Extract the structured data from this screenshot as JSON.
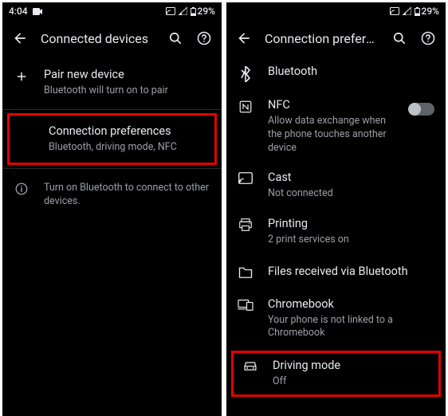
{
  "statusbar": {
    "time": "4:04",
    "battery": "29%"
  },
  "left": {
    "title": "Connected devices",
    "rows": [
      {
        "primary": "Pair new device",
        "secondary": "Bluetooth will turn on to pair"
      },
      {
        "primary": "Connection preferences",
        "secondary": "Bluetooth, driving mode, NFC"
      }
    ],
    "info": "Turn on Bluetooth to connect to other devices."
  },
  "right": {
    "title": "Connection preferen...",
    "rows": [
      {
        "primary": "Bluetooth"
      },
      {
        "primary": "NFC",
        "secondary": "Allow data exchange when the phone touches another device"
      },
      {
        "primary": "Cast",
        "secondary": "Not connected"
      },
      {
        "primary": "Printing",
        "secondary": "2 print services on"
      },
      {
        "primary": "Files received via Bluetooth"
      },
      {
        "primary": "Chromebook",
        "secondary": "Your phone is not linked to a Chromebook"
      },
      {
        "primary": "Driving mode",
        "secondary": "Off"
      }
    ]
  }
}
